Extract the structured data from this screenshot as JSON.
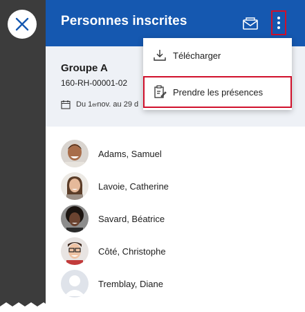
{
  "header": {
    "title": "Personnes inscrites"
  },
  "group": {
    "name": "Groupe A",
    "code": "160-RH-00001-02",
    "dates_prefix": "Du 1",
    "dates_sup": "er",
    "dates_suffix": " nov. au 29 d"
  },
  "menu": {
    "items": [
      {
        "label": "Télécharger",
        "icon": "download-icon"
      },
      {
        "label": "Prendre les présences",
        "icon": "clipboard-attendance-icon"
      }
    ]
  },
  "people": [
    {
      "name": "Adams, Samuel"
    },
    {
      "name": "Lavoie, Catherine"
    },
    {
      "name": "Savard, Béatrice"
    },
    {
      "name": "Côté, Christophe"
    },
    {
      "name": "Tremblay, Diane"
    }
  ],
  "colors": {
    "header_blue": "#1558b0",
    "rail": "#3c3c3c",
    "card_bg": "#eef1f6",
    "highlight_red": "#d0102b"
  }
}
